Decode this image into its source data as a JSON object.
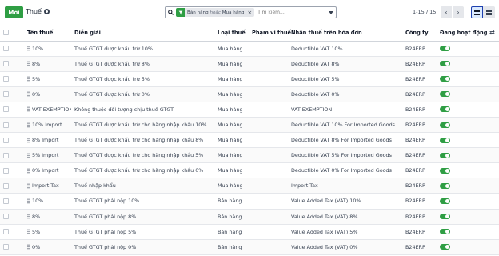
{
  "control_panel": {
    "new_button": "Mới",
    "title": "Thuế",
    "search": {
      "facet_label": "Bán hàng",
      "facet_or": "hoặc",
      "facet_value": "Mua hàng",
      "facet_remove": "×",
      "placeholder": "Tìm kiếm..."
    },
    "pager": {
      "text": "1-15 / 15",
      "prev": "‹",
      "next": "›"
    }
  },
  "table": {
    "columns": {
      "name": "Tên thuế",
      "description": "Diễn giải",
      "type": "Loại thuế",
      "scope": "Phạm vi thuế",
      "label": "Nhãn thuế trên hóa đơn",
      "company": "Công ty",
      "active": "Đang hoạt động"
    },
    "rows": [
      {
        "name": "10%",
        "description": "Thuế GTGT được khấu trừ 10%",
        "type": "Mua hàng",
        "scope": "",
        "label": "Deductible VAT 10%",
        "company": "B24ERP",
        "active": true
      },
      {
        "name": "8%",
        "description": "Thuế GTGT được khấu trừ 8%",
        "type": "Mua hàng",
        "scope": "",
        "label": "Deductible VAT 8%",
        "company": "B24ERP",
        "active": true
      },
      {
        "name": "5%",
        "description": "Thuế GTGT được khấu trừ 5%",
        "type": "Mua hàng",
        "scope": "",
        "label": "Deductible VAT 5%",
        "company": "B24ERP",
        "active": true
      },
      {
        "name": "0%",
        "description": "Thuế GTGT được khấu trừ 0%",
        "type": "Mua hàng",
        "scope": "",
        "label": "Deductible VAT 0%",
        "company": "B24ERP",
        "active": true
      },
      {
        "name": "VAT EXEMPTION",
        "description": "Không thuộc đối tượng chịu thuế GTGT",
        "type": "Mua hàng",
        "scope": "",
        "label": "VAT EXEMPTION",
        "company": "B24ERP",
        "active": true
      },
      {
        "name": "10% Import",
        "description": "Thuế GTGT được khấu trừ cho hàng nhập khẩu 10%",
        "type": "Mua hàng",
        "scope": "",
        "label": "Deductible VAT 10% For Imported Goods",
        "company": "B24ERP",
        "active": true
      },
      {
        "name": "8% Import",
        "description": "Thuế GTGT được khấu trừ cho hàng nhập khẩu 8%",
        "type": "Mua hàng",
        "scope": "",
        "label": "Deductible VAT 8% For Imported Goods",
        "company": "B24ERP",
        "active": true
      },
      {
        "name": "5% Import",
        "description": "Thuế GTGT được khấu trừ cho hàng nhập khẩu 5%",
        "type": "Mua hàng",
        "scope": "",
        "label": "Deductible VAT 5% For Imported Goods",
        "company": "B24ERP",
        "active": true
      },
      {
        "name": "0% Import",
        "description": "Thuế GTGT được khấu trừ cho hàng nhập khẩu 0%",
        "type": "Mua hàng",
        "scope": "",
        "label": "Deductible VAT 0% For Imported Goods",
        "company": "B24ERP",
        "active": true
      },
      {
        "name": "Import Tax",
        "description": "Thuế nhập khẩu",
        "type": "Mua hàng",
        "scope": "",
        "label": "Import Tax",
        "company": "B24ERP",
        "active": true
      },
      {
        "name": "10%",
        "description": "Thuế GTGT phải nộp 10%",
        "type": "Bán hàng",
        "scope": "",
        "label": "Value Added Tax (VAT) 10%",
        "company": "B24ERP",
        "active": true
      },
      {
        "name": "8%",
        "description": "Thuế GTGT phải nộp 8%",
        "type": "Bán hàng",
        "scope": "",
        "label": "Value Added Tax (VAT) 8%",
        "company": "B24ERP",
        "active": true
      },
      {
        "name": "5%",
        "description": "Thuế GTGT phải nộp 5%",
        "type": "Bán hàng",
        "scope": "",
        "label": "Value Added Tax (VAT) 5%",
        "company": "B24ERP",
        "active": true
      },
      {
        "name": "0%",
        "description": "Thuế GTGT phải nộp 0%",
        "type": "Bán hàng",
        "scope": "",
        "label": "Value Added Tax (VAT) 0%",
        "company": "B24ERP",
        "active": true
      }
    ]
  },
  "colors": {
    "accent": "#2f9e44",
    "view_active": "#1e40af"
  }
}
